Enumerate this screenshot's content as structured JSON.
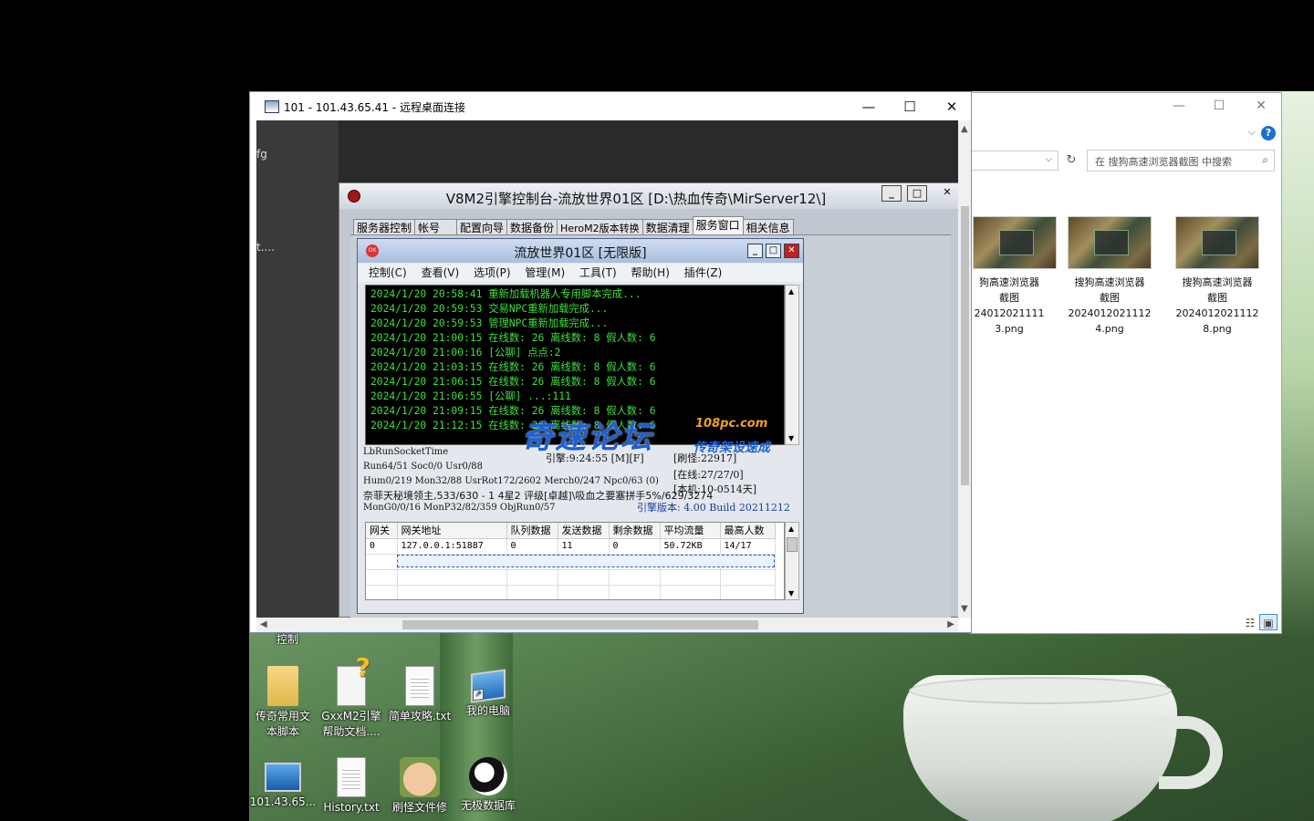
{
  "explorer": {
    "search_placeholder": "在 搜狗高速浏览器截图 中搜索",
    "thumbnails": [
      {
        "line1": "狗高速浏览器",
        "line2": "截图",
        "line3": "24012021111",
        "line4": "3.png"
      },
      {
        "line1": "搜狗高速浏览器",
        "line2": "截图",
        "line3": "2024012021112",
        "line4": "4.png"
      },
      {
        "line1": "搜狗高速浏览器",
        "line2": "截图",
        "line3": "2024012021112",
        "line4": "8.png"
      }
    ]
  },
  "rdp": {
    "title": "101 - 101.43.65.41 - 远程桌面连接",
    "remote_texts": {
      "fg": "fg",
      "t": "t...."
    }
  },
  "v8": {
    "title": "V8M2引擎控制台-流放世界01区 [D:\\热血传奇\\MirServer12\\]",
    "tabs": [
      "服务器控制",
      "帐号",
      "配置向导",
      "数据备份",
      "HeroM2版本转换",
      "数据清理",
      "服务窗口",
      "相关信息"
    ],
    "active_tab": "服务窗口"
  },
  "gameserver": {
    "title": "流放世界01区 [无限版]",
    "menu": [
      "控制(C)",
      "查看(V)",
      "选项(P)",
      "管理(M)",
      "工具(T)",
      "帮助(H)",
      "插件(Z)"
    ],
    "log": [
      "2024/1/20 20:58:41 重新加载机器人专用脚本完成...",
      "2024/1/20 20:59:53 交易NPC重新加载完成...",
      "2024/1/20 20:59:53 管理NPC重新加载完成...",
      "2024/1/20 21:00:15 在线数: 26 离线数: 8 假人数: 6",
      "2024/1/20 21:00:16 [公聊] 点点:2",
      "2024/1/20 21:03:15 在线数: 26 离线数: 8 假人数: 6",
      "2024/1/20 21:06:15 在线数: 26 离线数: 8 假人数: 6",
      "2024/1/20 21:06:55 [公聊] ...:111",
      "2024/1/20 21:09:15 在线数: 26 离线数: 8 假人数: 6",
      "2024/1/20 21:12:15 在线数: 26 离线数: 8 假人数: 6"
    ],
    "stats": {
      "lbrun": "LbRunSocketTime",
      "engine_time": "引擎:9:24:55 [M][F]",
      "monster_refresh": "[刷怪:22917]",
      "run": "Run64/51 Soc0/0 Usr0/88",
      "online": "[在线:27/27/0]",
      "hum": "Hum0/219 Mon32/88 UsrRot172/2602 Merch0/247 Npc0/63 (0)",
      "local": "[本机:10-0514天]",
      "notice": "奈菲天秘境领主,533/630 - 1 4星2 评级[卓越]\\吸血之要塞拼手5%/629/3274",
      "mon": "MonG0/0/16 MonP32/82/359 ObjRun0/57",
      "version": "引擎版本: 4.00 Build 20211212"
    },
    "watermark": {
      "main": "奇速论坛",
      "url": "108pc.com",
      "sub": "传奇架设速成"
    },
    "table": {
      "headers": [
        "网关",
        "网关地址",
        "队列数据",
        "发送数据",
        "剩余数据",
        "平均流量",
        "最高人数"
      ],
      "rows": [
        [
          "0",
          "127.0.0.1:51887",
          "0",
          "11",
          "0",
          "50.72KB",
          "14/17"
        ]
      ]
    }
  },
  "desktop": {
    "partial_label": "控制",
    "icons": [
      {
        "label1": "传奇常用文",
        "label2": "本脚本"
      },
      {
        "label1": "GxxM2引擎",
        "label2": "帮助文档...."
      },
      {
        "label1": "简单攻略.txt",
        "label2": ""
      },
      {
        "label1": "我的电脑",
        "label2": ""
      },
      {
        "label1": "101.43.65...",
        "label2": ""
      },
      {
        "label1": "History.txt",
        "label2": ""
      },
      {
        "label1": "刷怪文件修",
        "label2": ""
      },
      {
        "label1": "无极数据库",
        "label2": ""
      }
    ]
  }
}
